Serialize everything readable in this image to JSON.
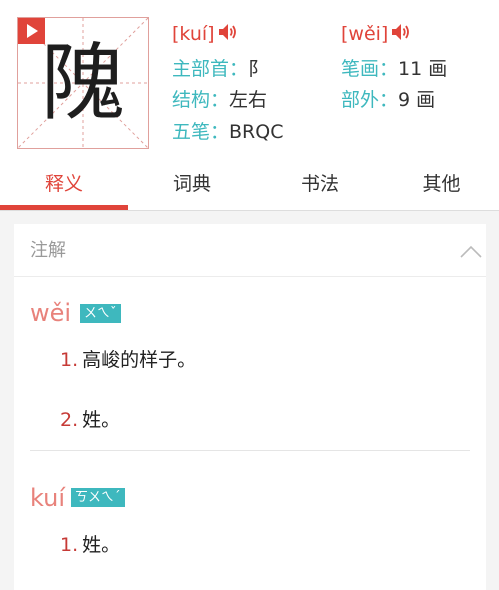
{
  "entry": {
    "character": "隗",
    "pronunciations": [
      {
        "bracket": "[kuí]",
        "pinyin": "kuí",
        "bopomofo": "ㄎㄨㄟˊ"
      },
      {
        "bracket": "[wěi]",
        "pinyin": "wěi",
        "bopomofo": "ㄨㄟˇ"
      }
    ],
    "info": {
      "radical_label": "主部首：",
      "radical_value": "阝",
      "strokes_label": "笔画：",
      "strokes_value": "11 画",
      "structure_label": "结构：",
      "structure_value": "左右",
      "extra_label": "部外：",
      "extra_value": "9 画",
      "wubi_label": "五笔：",
      "wubi_value": "BRQC"
    }
  },
  "tabs": [
    {
      "label": "释义",
      "active": true
    },
    {
      "label": "词典",
      "active": false
    },
    {
      "label": "书法",
      "active": false
    },
    {
      "label": "其他",
      "active": false
    }
  ],
  "card": {
    "title": "注解",
    "groups": [
      {
        "pinyin": "wěi",
        "bopomofo": "ㄨㄟˇ",
        "definitions": [
          {
            "num": "1.",
            "text": "高峻的样子。"
          },
          {
            "num": "2.",
            "text": "姓。"
          }
        ]
      },
      {
        "pinyin": "kuí",
        "bopomofo": "ㄎㄨㄟˊ",
        "definitions": [
          {
            "num": "1.",
            "text": "姓。"
          }
        ]
      }
    ]
  },
  "icons": {
    "play": "play-icon",
    "speaker": "speaker-icon",
    "collapse": "chevron-up-icon"
  },
  "colors": {
    "accent_red": "#e0443a",
    "label_teal": "#3eb8be",
    "pinyin_latin": "#e8827b",
    "grid_line": "#e0a09c"
  }
}
